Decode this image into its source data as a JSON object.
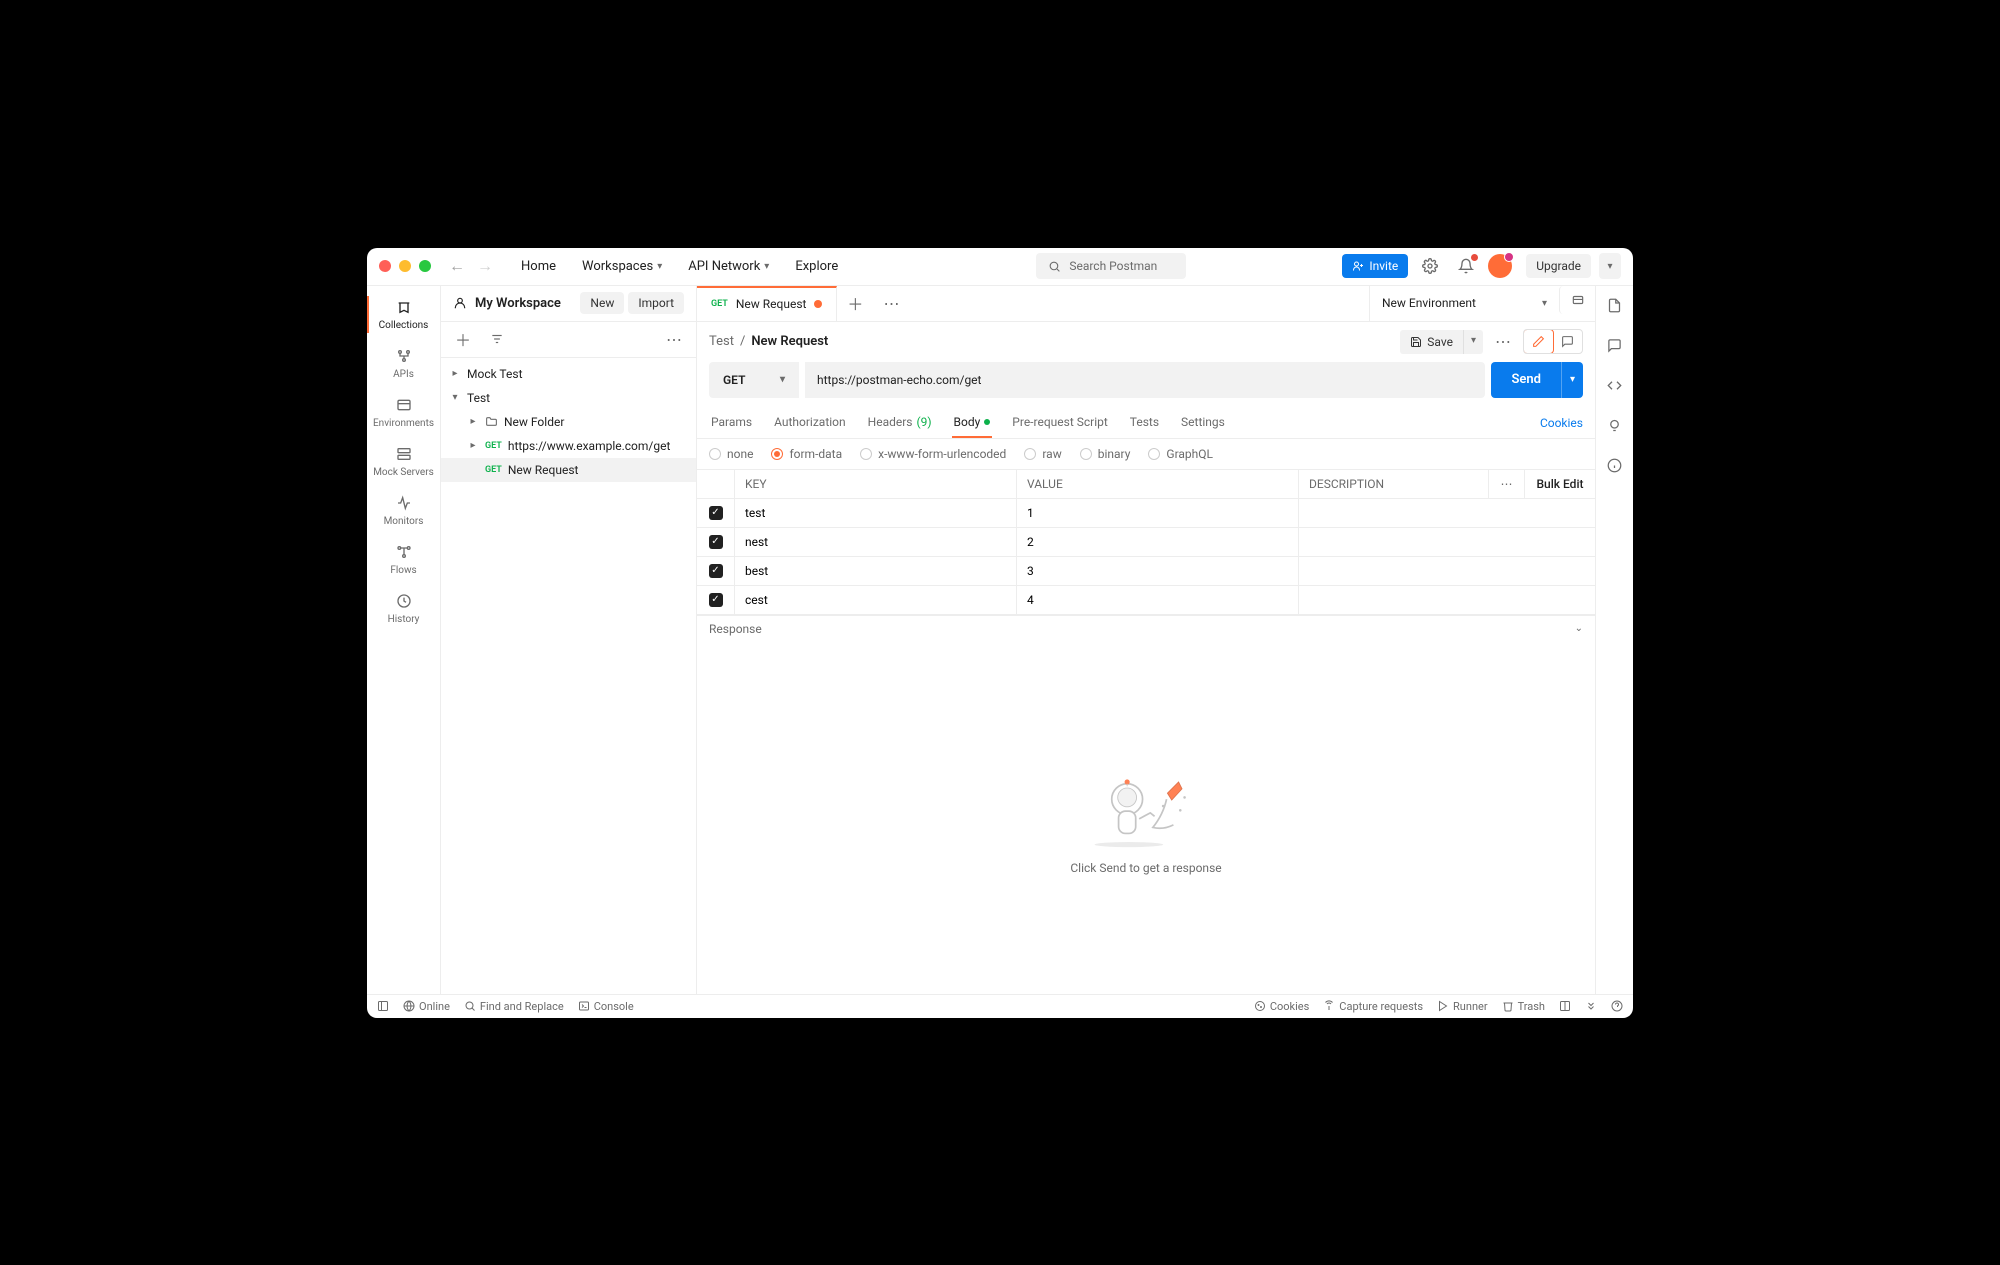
{
  "window": {
    "nav": [
      "Home",
      "Workspaces",
      "API Network",
      "Explore"
    ],
    "search_placeholder": "Search Postman",
    "invite": "Invite",
    "upgrade": "Upgrade"
  },
  "workspace": {
    "title": "My Workspace",
    "new": "New",
    "import": "Import"
  },
  "rail": [
    {
      "label": "Collections",
      "active": true
    },
    {
      "label": "APIs"
    },
    {
      "label": "Environments"
    },
    {
      "label": "Mock Servers"
    },
    {
      "label": "Monitors"
    },
    {
      "label": "Flows"
    },
    {
      "label": "History"
    }
  ],
  "tree": {
    "items": [
      {
        "label": "Mock Test",
        "type": "collection",
        "depth": 0,
        "expanded": false
      },
      {
        "label": "Test",
        "type": "collection",
        "depth": 0,
        "expanded": true
      },
      {
        "label": "New Folder",
        "type": "folder",
        "depth": 1
      },
      {
        "label": "https://www.example.com/get",
        "type": "request",
        "method": "GET",
        "depth": 1
      },
      {
        "label": "New Request",
        "type": "request",
        "method": "GET",
        "depth": 1,
        "selected": true
      }
    ]
  },
  "tabs": {
    "active": {
      "method": "GET",
      "label": "New Request",
      "dirty": true
    },
    "env": "New Environment"
  },
  "breadcrumb": {
    "parent": "Test",
    "current": "New Request",
    "save": "Save"
  },
  "request": {
    "method": "GET",
    "url": "https://postman-echo.com/get",
    "send": "Send",
    "tabs": [
      "Params",
      "Authorization",
      "Headers",
      "Body",
      "Pre-request Script",
      "Tests",
      "Settings"
    ],
    "headers_count": "(9)",
    "active_tab": "Body",
    "cookies": "Cookies",
    "body_types": [
      "none",
      "form-data",
      "x-www-form-urlencoded",
      "raw",
      "binary",
      "GraphQL"
    ],
    "body_type_selected": "form-data",
    "kv": {
      "headers": {
        "key": "KEY",
        "value": "VALUE",
        "desc": "DESCRIPTION",
        "bulk": "Bulk Edit"
      },
      "rows": [
        {
          "checked": true,
          "key": "test",
          "value": "1",
          "desc": ""
        },
        {
          "checked": true,
          "key": "nest",
          "value": "2",
          "desc": ""
        },
        {
          "checked": true,
          "key": "best",
          "value": "3",
          "desc": ""
        },
        {
          "checked": true,
          "key": "cest",
          "value": "4",
          "desc": ""
        }
      ]
    }
  },
  "response": {
    "title": "Response",
    "empty": "Click Send to get a response"
  },
  "statusbar": {
    "online": "Online",
    "find": "Find and Replace",
    "console": "Console",
    "cookies": "Cookies",
    "capture": "Capture requests",
    "runner": "Runner",
    "trash": "Trash"
  }
}
